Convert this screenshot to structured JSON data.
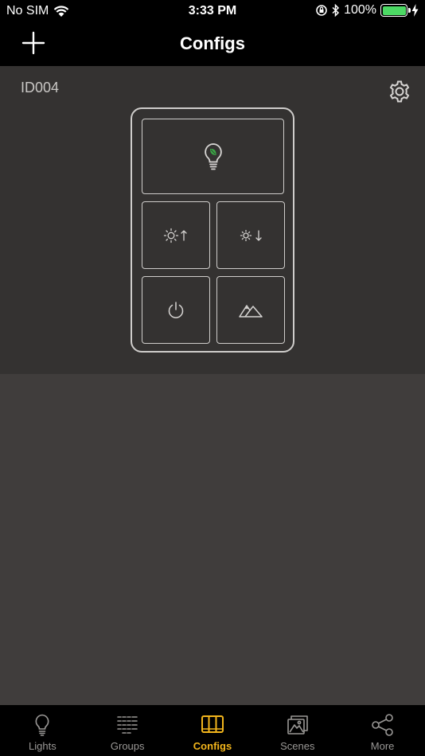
{
  "status_bar": {
    "carrier": "No SIM",
    "time": "3:33 PM",
    "battery_percent": "100%",
    "battery_level": 1.0,
    "battery_color": "#4cd964"
  },
  "nav": {
    "title": "Configs",
    "add_icon": "plus-icon"
  },
  "config": {
    "id": "ID004",
    "settings_icon": "gear-icon",
    "remote_buttons": [
      {
        "icon": "lightbulb-leaf-icon"
      },
      {
        "icon": "brightness-up-icon"
      },
      {
        "icon": "brightness-down-icon"
      },
      {
        "icon": "power-icon"
      },
      {
        "icon": "scene-mountains-icon"
      }
    ]
  },
  "tabs": [
    {
      "label": "Lights",
      "icon": "lightbulb-icon",
      "active": false
    },
    {
      "label": "Groups",
      "icon": "groups-icon",
      "active": false
    },
    {
      "label": "Configs",
      "icon": "configs-icon",
      "active": true
    },
    {
      "label": "Scenes",
      "icon": "scenes-icon",
      "active": false
    },
    {
      "label": "More",
      "icon": "share-icon",
      "active": false
    }
  ],
  "colors": {
    "accent": "#f2b51c",
    "inactive_tab": "#9a9896",
    "leaf_green": "#3aa845"
  }
}
